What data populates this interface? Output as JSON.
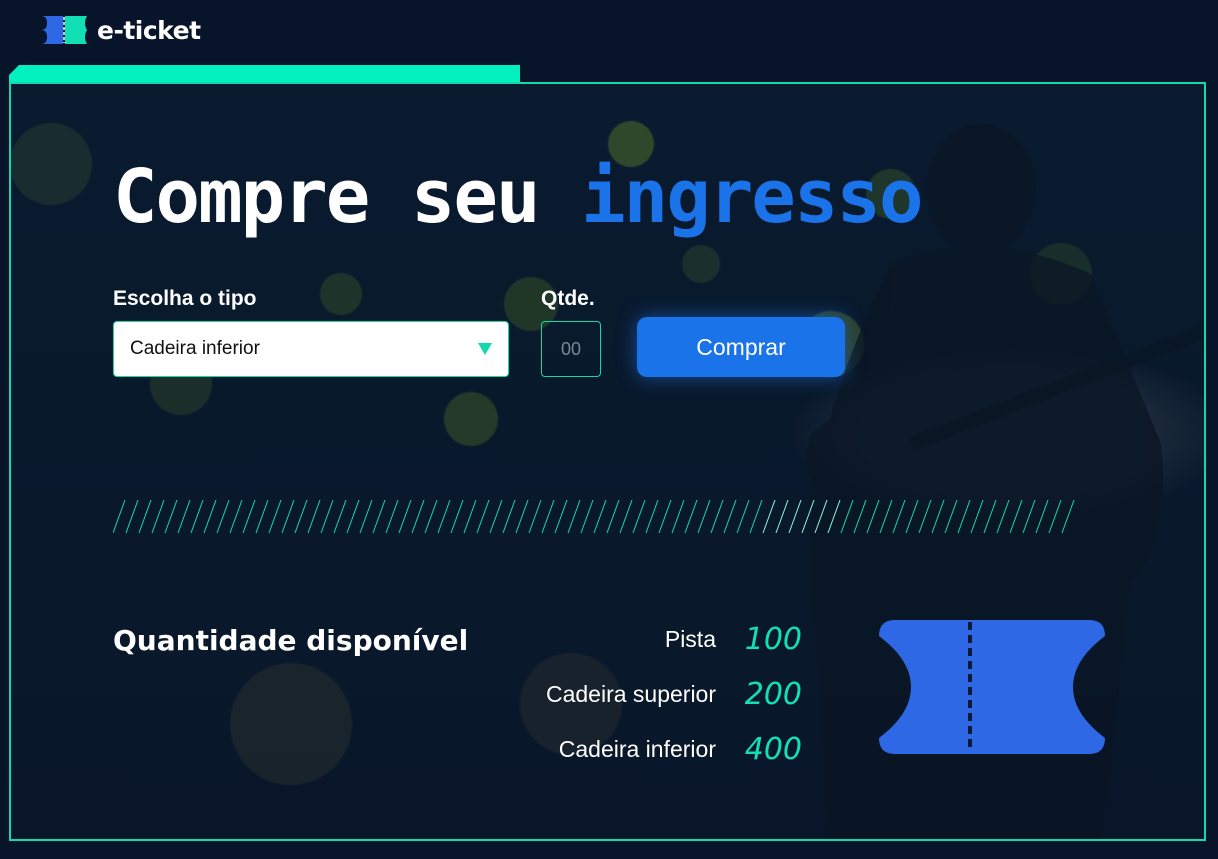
{
  "brand": {
    "name": "e-ticket",
    "colors": {
      "accent": "#10d9b0",
      "primary": "#1a73e8",
      "ticket": "#2f68e5",
      "background": "#07142a"
    }
  },
  "hero": {
    "title_plain": "Compre seu",
    "title_accent": "ingresso"
  },
  "form": {
    "type_label": "Escolha o tipo",
    "type_selected": "Cadeira inferior",
    "qty_label": "Qtde.",
    "qty_placeholder": "00",
    "submit_label": "Comprar"
  },
  "availability": {
    "title": "Quantidade disponível",
    "items": [
      {
        "name": "Pista",
        "value": "100"
      },
      {
        "name": "Cadeira superior",
        "value": "200"
      },
      {
        "name": "Cadeira inferior",
        "value": "400"
      }
    ]
  },
  "icons": {
    "logo": "ticket-logo-icon",
    "select_arrow": "triangle-down-icon",
    "illustration": "ticket-illustration-icon"
  }
}
